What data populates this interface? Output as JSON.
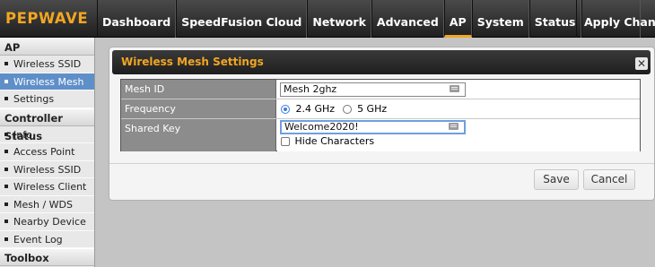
{
  "brand": {
    "logo_text": "PEPWAVE",
    "accent": "#f2a622"
  },
  "nav": {
    "tabs": [
      "Dashboard",
      "SpeedFusion Cloud",
      "Network",
      "Advanced",
      "AP",
      "System",
      "Status"
    ],
    "active": "AP",
    "apply_label": "Apply Changes"
  },
  "sidebar": {
    "section1": "AP",
    "ap_items": [
      "Wireless SSID",
      "Wireless Mesh",
      "Settings"
    ],
    "section2": "Controller Status",
    "status_items": [
      "Info",
      "Access Point",
      "Wireless SSID",
      "Wireless Client",
      "Mesh / WDS",
      "Nearby Device",
      "Event Log"
    ],
    "section3": "Toolbox",
    "active_item": "Wireless Mesh"
  },
  "dialog": {
    "title": "Wireless Mesh Settings",
    "close_icon": "close-icon",
    "fields": {
      "mesh_id_label": "Mesh ID",
      "mesh_id_value": "Mesh 2ghz",
      "frequency_label": "Frequency",
      "freq_option_1": "2.4 GHz",
      "freq_option_2": "5 GHz",
      "freq_selected": "2.4 GHz",
      "shared_key_label": "Shared Key",
      "shared_key_value": "Welcome2020!",
      "hide_characters_label": "Hide Characters"
    },
    "save_label": "Save",
    "cancel_label": "Cancel"
  }
}
